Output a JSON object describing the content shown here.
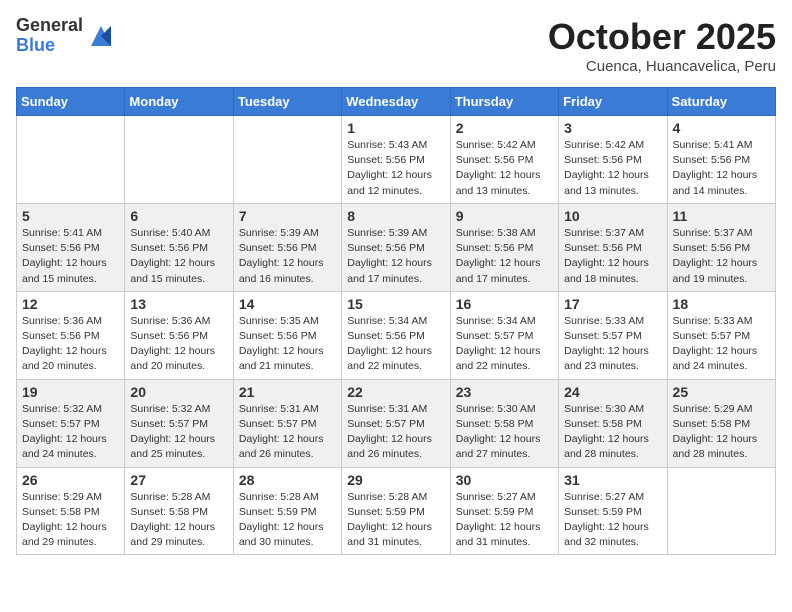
{
  "header": {
    "logo_general": "General",
    "logo_blue": "Blue",
    "month": "October 2025",
    "location": "Cuenca, Huancavelica, Peru"
  },
  "weekdays": [
    "Sunday",
    "Monday",
    "Tuesday",
    "Wednesday",
    "Thursday",
    "Friday",
    "Saturday"
  ],
  "weeks": [
    [
      {
        "day": "",
        "info": ""
      },
      {
        "day": "",
        "info": ""
      },
      {
        "day": "",
        "info": ""
      },
      {
        "day": "1",
        "info": "Sunrise: 5:43 AM\nSunset: 5:56 PM\nDaylight: 12 hours\nand 12 minutes."
      },
      {
        "day": "2",
        "info": "Sunrise: 5:42 AM\nSunset: 5:56 PM\nDaylight: 12 hours\nand 13 minutes."
      },
      {
        "day": "3",
        "info": "Sunrise: 5:42 AM\nSunset: 5:56 PM\nDaylight: 12 hours\nand 13 minutes."
      },
      {
        "day": "4",
        "info": "Sunrise: 5:41 AM\nSunset: 5:56 PM\nDaylight: 12 hours\nand 14 minutes."
      }
    ],
    [
      {
        "day": "5",
        "info": "Sunrise: 5:41 AM\nSunset: 5:56 PM\nDaylight: 12 hours\nand 15 minutes."
      },
      {
        "day": "6",
        "info": "Sunrise: 5:40 AM\nSunset: 5:56 PM\nDaylight: 12 hours\nand 15 minutes."
      },
      {
        "day": "7",
        "info": "Sunrise: 5:39 AM\nSunset: 5:56 PM\nDaylight: 12 hours\nand 16 minutes."
      },
      {
        "day": "8",
        "info": "Sunrise: 5:39 AM\nSunset: 5:56 PM\nDaylight: 12 hours\nand 17 minutes."
      },
      {
        "day": "9",
        "info": "Sunrise: 5:38 AM\nSunset: 5:56 PM\nDaylight: 12 hours\nand 17 minutes."
      },
      {
        "day": "10",
        "info": "Sunrise: 5:37 AM\nSunset: 5:56 PM\nDaylight: 12 hours\nand 18 minutes."
      },
      {
        "day": "11",
        "info": "Sunrise: 5:37 AM\nSunset: 5:56 PM\nDaylight: 12 hours\nand 19 minutes."
      }
    ],
    [
      {
        "day": "12",
        "info": "Sunrise: 5:36 AM\nSunset: 5:56 PM\nDaylight: 12 hours\nand 20 minutes."
      },
      {
        "day": "13",
        "info": "Sunrise: 5:36 AM\nSunset: 5:56 PM\nDaylight: 12 hours\nand 20 minutes."
      },
      {
        "day": "14",
        "info": "Sunrise: 5:35 AM\nSunset: 5:56 PM\nDaylight: 12 hours\nand 21 minutes."
      },
      {
        "day": "15",
        "info": "Sunrise: 5:34 AM\nSunset: 5:56 PM\nDaylight: 12 hours\nand 22 minutes."
      },
      {
        "day": "16",
        "info": "Sunrise: 5:34 AM\nSunset: 5:57 PM\nDaylight: 12 hours\nand 22 minutes."
      },
      {
        "day": "17",
        "info": "Sunrise: 5:33 AM\nSunset: 5:57 PM\nDaylight: 12 hours\nand 23 minutes."
      },
      {
        "day": "18",
        "info": "Sunrise: 5:33 AM\nSunset: 5:57 PM\nDaylight: 12 hours\nand 24 minutes."
      }
    ],
    [
      {
        "day": "19",
        "info": "Sunrise: 5:32 AM\nSunset: 5:57 PM\nDaylight: 12 hours\nand 24 minutes."
      },
      {
        "day": "20",
        "info": "Sunrise: 5:32 AM\nSunset: 5:57 PM\nDaylight: 12 hours\nand 25 minutes."
      },
      {
        "day": "21",
        "info": "Sunrise: 5:31 AM\nSunset: 5:57 PM\nDaylight: 12 hours\nand 26 minutes."
      },
      {
        "day": "22",
        "info": "Sunrise: 5:31 AM\nSunset: 5:57 PM\nDaylight: 12 hours\nand 26 minutes."
      },
      {
        "day": "23",
        "info": "Sunrise: 5:30 AM\nSunset: 5:58 PM\nDaylight: 12 hours\nand 27 minutes."
      },
      {
        "day": "24",
        "info": "Sunrise: 5:30 AM\nSunset: 5:58 PM\nDaylight: 12 hours\nand 28 minutes."
      },
      {
        "day": "25",
        "info": "Sunrise: 5:29 AM\nSunset: 5:58 PM\nDaylight: 12 hours\nand 28 minutes."
      }
    ],
    [
      {
        "day": "26",
        "info": "Sunrise: 5:29 AM\nSunset: 5:58 PM\nDaylight: 12 hours\nand 29 minutes."
      },
      {
        "day": "27",
        "info": "Sunrise: 5:28 AM\nSunset: 5:58 PM\nDaylight: 12 hours\nand 29 minutes."
      },
      {
        "day": "28",
        "info": "Sunrise: 5:28 AM\nSunset: 5:59 PM\nDaylight: 12 hours\nand 30 minutes."
      },
      {
        "day": "29",
        "info": "Sunrise: 5:28 AM\nSunset: 5:59 PM\nDaylight: 12 hours\nand 31 minutes."
      },
      {
        "day": "30",
        "info": "Sunrise: 5:27 AM\nSunset: 5:59 PM\nDaylight: 12 hours\nand 31 minutes."
      },
      {
        "day": "31",
        "info": "Sunrise: 5:27 AM\nSunset: 5:59 PM\nDaylight: 12 hours\nand 32 minutes."
      },
      {
        "day": "",
        "info": ""
      }
    ]
  ]
}
